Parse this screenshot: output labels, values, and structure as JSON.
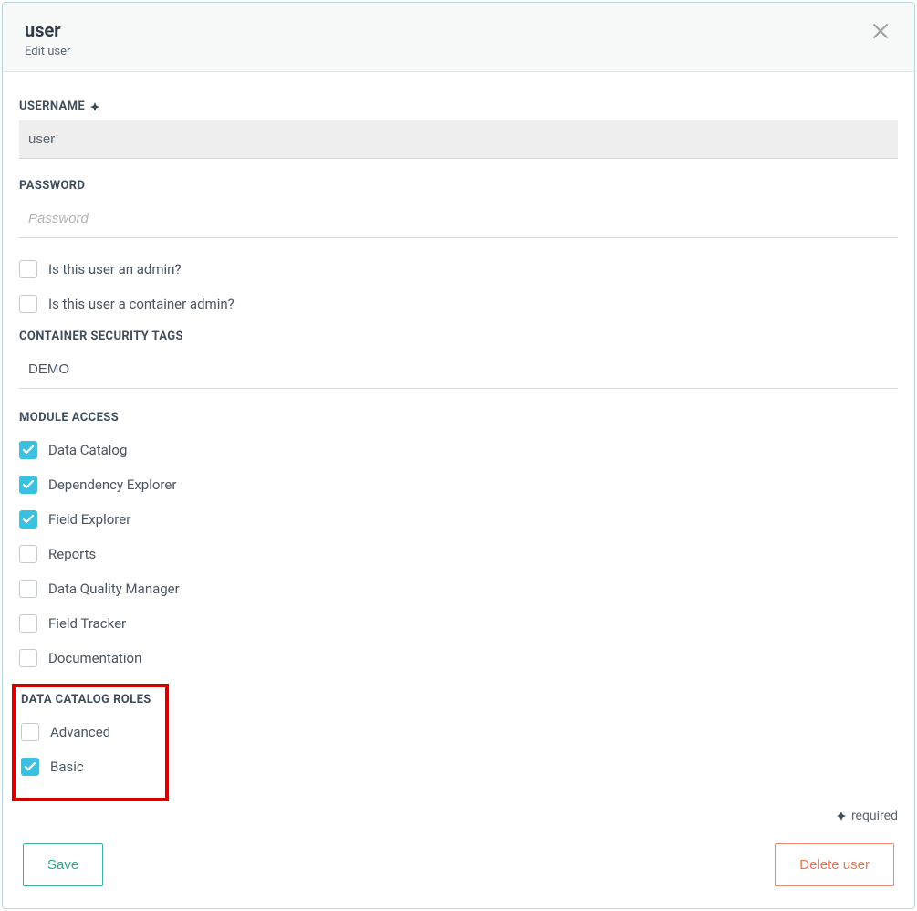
{
  "header": {
    "title": "user",
    "subtitle": "Edit user"
  },
  "fields": {
    "username_label": "Username",
    "username_value": "user",
    "password_label": "Password",
    "password_placeholder": "Password",
    "admin_checkbox_label": "Is this user an admin?",
    "container_admin_checkbox_label": "Is this user a container admin?",
    "security_tags_label": "Container Security Tags",
    "security_tags_value": "DEMO"
  },
  "module_access": {
    "label": "Module Access",
    "items": [
      {
        "label": "Data Catalog",
        "checked": true
      },
      {
        "label": "Dependency Explorer",
        "checked": true
      },
      {
        "label": "Field Explorer",
        "checked": true
      },
      {
        "label": "Reports",
        "checked": false
      },
      {
        "label": "Data Quality Manager",
        "checked": false
      },
      {
        "label": "Field Tracker",
        "checked": false
      },
      {
        "label": "Documentation",
        "checked": false
      }
    ]
  },
  "data_catalog_roles": {
    "label": "Data Catalog Roles",
    "items": [
      {
        "label": "Advanced",
        "checked": false
      },
      {
        "label": "Basic",
        "checked": true
      }
    ]
  },
  "footer": {
    "required_text": "required",
    "save_label": "Save",
    "delete_label": "Delete user"
  }
}
